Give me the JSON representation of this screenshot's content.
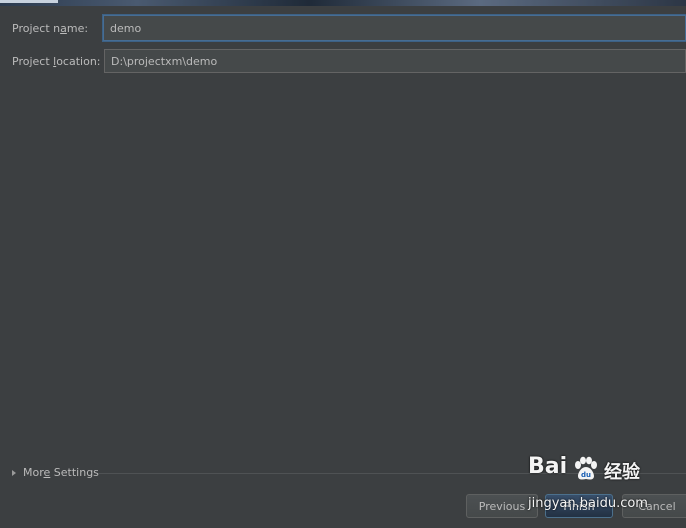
{
  "form": {
    "project_name_label_pre": "Project n",
    "project_name_label_mnemonic": "a",
    "project_name_label_post": "me:",
    "project_name_value": "demo",
    "project_location_label_pre": "Project ",
    "project_location_label_mnemonic": "l",
    "project_location_label_post": "ocation:",
    "project_location_value": "D:\\projectxm\\demo"
  },
  "more_settings": {
    "label_pre": "Mor",
    "label_mnemonic": "e",
    "label_post": " Settings",
    "expanded": false
  },
  "buttons": {
    "previous": "Previous",
    "finish": "Finish",
    "cancel": "Cancel"
  },
  "watermark": {
    "logo_text": "Bai",
    "logo_suffix": "经验",
    "url": "jingyan.baidu.com"
  },
  "colors": {
    "background": "#3c3f41",
    "field_bg": "#45494a",
    "focus_border": "#466d94",
    "text": "#bbbbbb",
    "default_button": "#233143"
  }
}
